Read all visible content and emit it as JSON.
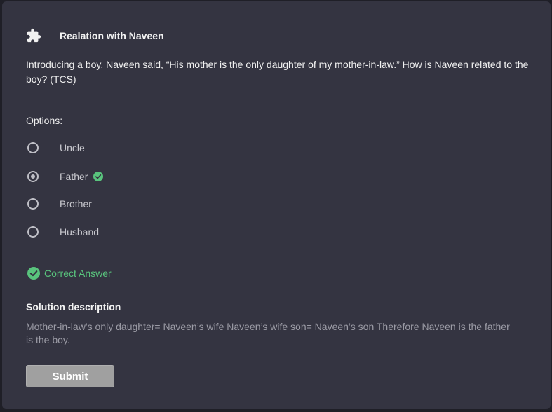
{
  "header": {
    "title": "Realation with Naveen",
    "icon": "puzzle-piece-icon"
  },
  "question": {
    "text": "Introducing a boy, Naveen said, “His mother is the only daughter of my mother-in-law.” How is Naveen related to the boy? (TCS)"
  },
  "options": {
    "label": "Options:",
    "items": [
      {
        "label": "Uncle",
        "selected": false,
        "correct": false
      },
      {
        "label": "Father",
        "selected": true,
        "correct": true
      },
      {
        "label": "Brother",
        "selected": false,
        "correct": false
      },
      {
        "label": "Husband",
        "selected": false,
        "correct": false
      }
    ]
  },
  "result": {
    "text": "Correct Answer",
    "color": "#59c47d"
  },
  "solution": {
    "title": "Solution description",
    "text": "Mother-in-law’s only daughter= Naveen’s wife Naveen’s wife son= Naveen’s son Therefore Naveen is the father is the boy."
  },
  "submit": {
    "label": "Submit"
  },
  "colors": {
    "background": "#1f1f27",
    "card": "#343441",
    "accent_green": "#59c47d",
    "button": "#a0a0a0"
  }
}
